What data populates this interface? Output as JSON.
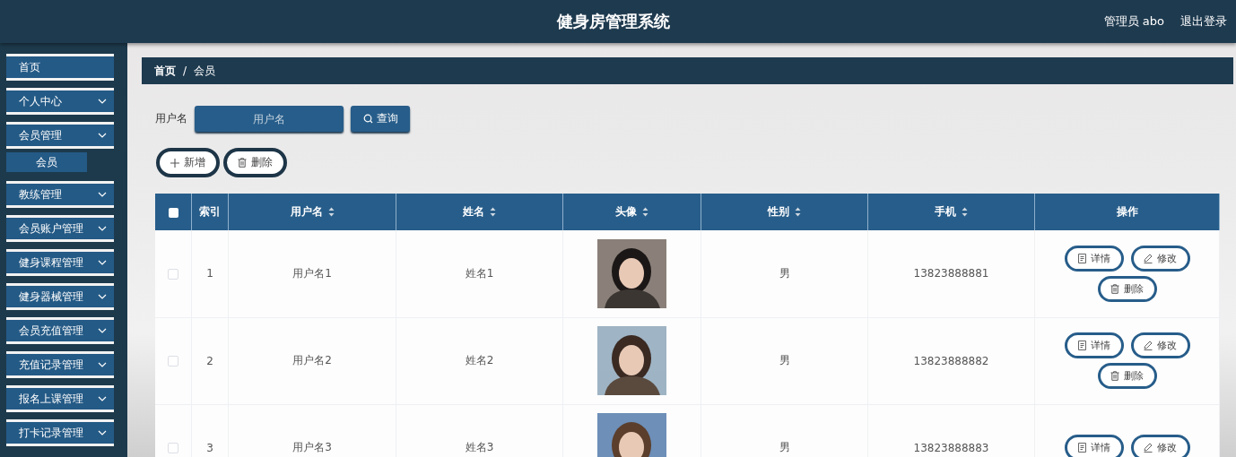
{
  "header": {
    "title": "健身房管理系统",
    "user": "管理员 abo",
    "logout": "退出登录"
  },
  "sidebar": {
    "items": [
      {
        "label": "首页",
        "expandable": false
      },
      {
        "label": "个人中心",
        "expandable": true
      },
      {
        "label": "会员管理",
        "expandable": true,
        "children": [
          {
            "label": "会员",
            "selected": true
          }
        ]
      },
      {
        "label": "教练管理",
        "expandable": true
      },
      {
        "label": "会员账户管理",
        "expandable": true
      },
      {
        "label": "健身课程管理",
        "expandable": true
      },
      {
        "label": "健身器械管理",
        "expandable": true
      },
      {
        "label": "会员充值管理",
        "expandable": true
      },
      {
        "label": "充值记录管理",
        "expandable": true
      },
      {
        "label": "报名上课管理",
        "expandable": true
      },
      {
        "label": "打卡记录管理",
        "expandable": true
      }
    ]
  },
  "breadcrumb": {
    "separator": "/",
    "items": [
      {
        "label": "首页",
        "current": false
      },
      {
        "label": "会员",
        "current": true
      }
    ]
  },
  "search": {
    "label": "用户名",
    "placeholder": "用户名",
    "button": "查询"
  },
  "actions": [
    {
      "kind": "add",
      "label": "新增"
    },
    {
      "kind": "delete",
      "label": "删除"
    }
  ],
  "table": {
    "select_all": {
      "checked": false
    },
    "columns": [
      {
        "label": "索引",
        "sortable": false
      },
      {
        "label": "用户名",
        "sortable": true
      },
      {
        "label": "姓名",
        "sortable": true
      },
      {
        "label": "头像",
        "sortable": true
      },
      {
        "label": "性别",
        "sortable": true
      },
      {
        "label": "手机",
        "sortable": true
      },
      {
        "label": "操作",
        "sortable": false
      }
    ],
    "rows": [
      {
        "checked": false,
        "index": "1",
        "username": "用户名1",
        "name": "姓名1",
        "avatar": {
          "kind": "picture"
        },
        "gender": "男",
        "phone": "13823888881",
        "buttons": [
          {
            "kind": "detail",
            "label": "详情"
          },
          {
            "kind": "edit",
            "label": "修改"
          },
          {
            "kind": "delete",
            "label": "删除"
          }
        ]
      },
      {
        "checked": false,
        "index": "2",
        "username": "用户名2",
        "name": "姓名2",
        "avatar": {
          "kind": "picture"
        },
        "gender": "男",
        "phone": "13823888882",
        "buttons": [
          {
            "kind": "detail",
            "label": "详情"
          },
          {
            "kind": "edit",
            "label": "修改"
          },
          {
            "kind": "delete",
            "label": "删除"
          }
        ]
      },
      {
        "checked": false,
        "index": "3",
        "username": "用户名3",
        "name": "姓名3",
        "avatar": {
          "kind": "picture"
        },
        "gender": "男",
        "phone": "13823888883",
        "buttons": [
          {
            "kind": "detail",
            "label": "详情"
          },
          {
            "kind": "edit",
            "label": "修改"
          }
        ]
      }
    ]
  }
}
